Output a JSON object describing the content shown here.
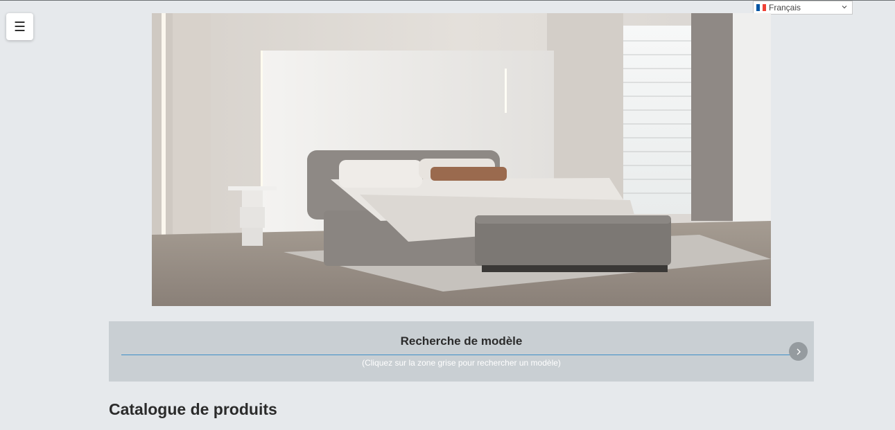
{
  "menu": {
    "icon": "hamburger-icon",
    "glyph": "☰"
  },
  "language_selector": {
    "selected": "Français",
    "flag": "france-flag-icon",
    "flag_colors": [
      "#0055a4",
      "#ffffff",
      "#ef4135"
    ]
  },
  "hero": {
    "image": "bedroom-hero-photo"
  },
  "model_search": {
    "title": "Recherche de modèle",
    "subtitle": "(Cliquez sur la zone grise pour rechercher un modèle)",
    "arrow_icon": "chevron-right-icon"
  },
  "catalog": {
    "heading": "Catalogue de produits"
  },
  "colors": {
    "background": "#e6e9ec",
    "panel": "#c9cfd3",
    "accent_line": "#3d8fc8"
  }
}
